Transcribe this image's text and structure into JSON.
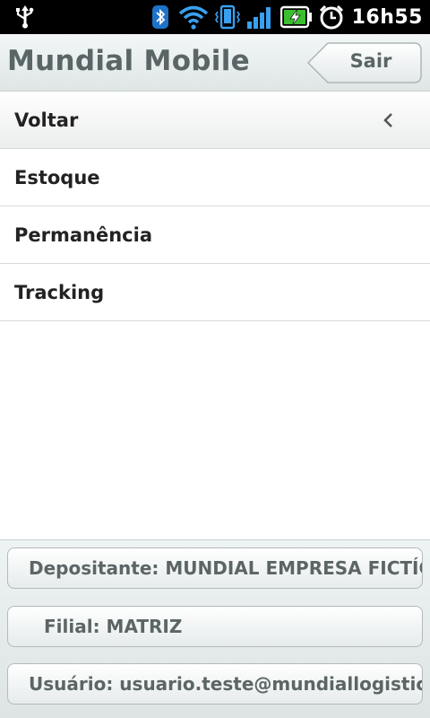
{
  "status_bar": {
    "time": "16h55",
    "icons": [
      "usb-icon",
      "bluetooth-icon",
      "wifi-icon",
      "vibrate-icon",
      "signal-icon",
      "battery-charging-icon",
      "alarm-icon"
    ]
  },
  "header": {
    "title": "Mundial Mobile",
    "back_button_label": "Sair"
  },
  "menu": {
    "items": [
      {
        "label": "Voltar"
      },
      {
        "label": "Estoque"
      },
      {
        "label": "Permanência"
      },
      {
        "label": "Tracking"
      }
    ]
  },
  "footer": {
    "depositante": "Depositante: MUNDIAL EMPRESA FICTÍCIA",
    "filial": "Filial: MATRIZ",
    "usuario": "Usuário: usuario.teste@mundiallogistics"
  },
  "colors": {
    "status_bar_bg": "#000000",
    "header_bg": "#e6ecec",
    "title_text": "#5a6566",
    "list_text": "#222222"
  }
}
